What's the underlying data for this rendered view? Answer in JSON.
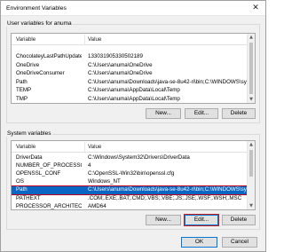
{
  "window": {
    "title": "Environment Variables",
    "close_glyph": "✕"
  },
  "user_section": {
    "label": "User variables for anuma",
    "headers": {
      "variable": "Variable",
      "value": "Value"
    },
    "rows": [
      {
        "variable": "ChocolateyLastPathUpdate",
        "value": "133031905330502189"
      },
      {
        "variable": "OneDrive",
        "value": "C:\\Users\\anuma\\OneDrive"
      },
      {
        "variable": "OneDriveConsumer",
        "value": "C:\\Users\\anuma\\OneDrive"
      },
      {
        "variable": "Path",
        "value": "C:\\Users\\anuma\\Downloads\\java-se-8u42-ri\\bin;C:\\WINDOWS\\syst..."
      },
      {
        "variable": "TEMP",
        "value": "C:\\Users\\anuma\\AppData\\Local\\Temp"
      },
      {
        "variable": "TMP",
        "value": "C:\\Users\\anuma\\AppData\\Local\\Temp"
      }
    ],
    "buttons": {
      "new": "New...",
      "edit": "Edit...",
      "delete": "Delete"
    }
  },
  "system_section": {
    "label": "System variables",
    "headers": {
      "variable": "Variable",
      "value": "Value"
    },
    "rows": [
      {
        "variable": "DriverData",
        "value": "C:\\Windows\\System32\\Drivers\\DriverData"
      },
      {
        "variable": "NUMBER_OF_PROCESSORS",
        "value": "4"
      },
      {
        "variable": "OPENSSL_CONF",
        "value": "C:\\OpenSSL-Win32\\bin\\openssl.cfg"
      },
      {
        "variable": "OS",
        "value": "Windows_NT"
      },
      {
        "variable": "Path",
        "value": "C:\\Users\\anuma\\Downloads\\java-se-8u42-ri\\bin;C:\\WINDOWS\\syst...",
        "selected": true
      },
      {
        "variable": "PATHEXT",
        "value": ".COM;.EXE;.BAT;.CMD;.VBS;.VBE;.JS;.JSE;.WSF;.WSH;.MSC"
      },
      {
        "variable": "PROCESSOR_ARCHITECTURE",
        "value": "AMD64"
      }
    ],
    "buttons": {
      "new": "New...",
      "edit": "Edit...",
      "delete": "Delete"
    }
  },
  "dialog_buttons": {
    "ok": "OK",
    "cancel": "Cancel"
  },
  "colors": {
    "selection": "#0a66c2",
    "focus_outline": "#cc1b1b",
    "primary_border": "#0078d7"
  },
  "icons": {
    "scroll_up": "chevron-up-icon",
    "scroll_down": "chevron-down-icon",
    "close": "close-icon"
  }
}
